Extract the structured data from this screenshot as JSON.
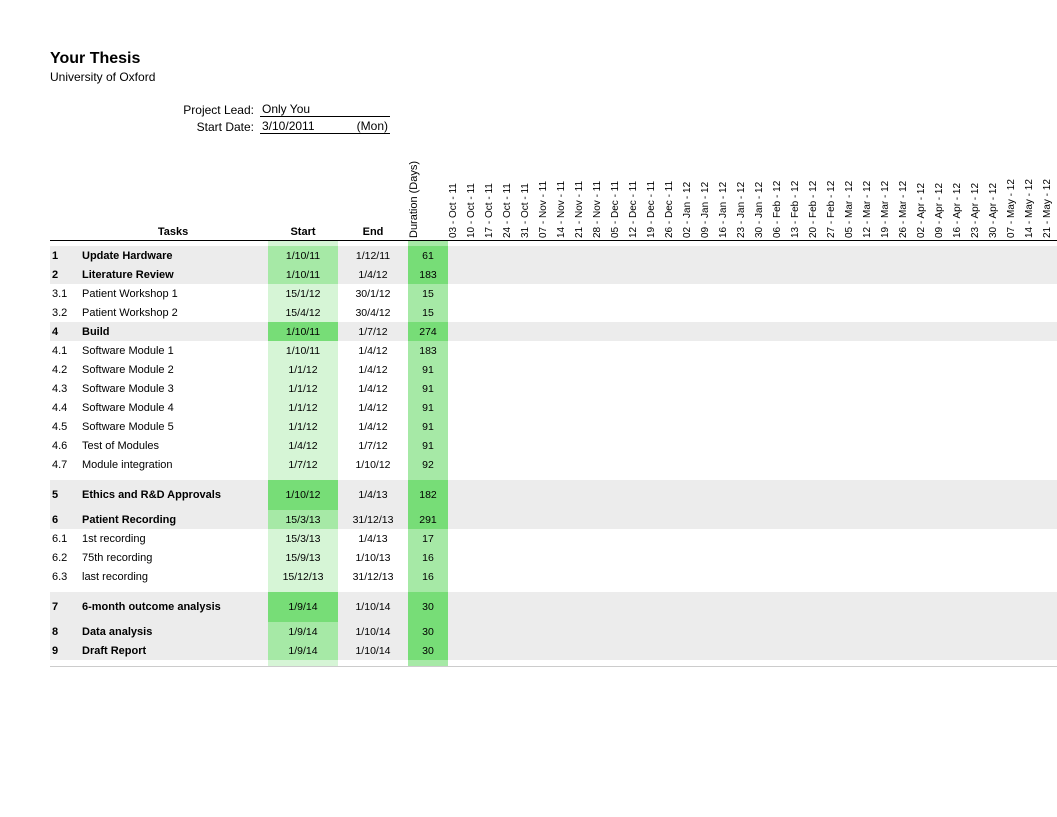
{
  "header": {
    "title": "Your Thesis",
    "subtitle": "University of Oxford",
    "project_lead_label": "Project Lead:",
    "project_lead_value": "Only You",
    "start_date_label": "Start Date:",
    "start_date_value": "3/10/2011",
    "start_date_dow": "(Mon)"
  },
  "columns": {
    "tasks": "Tasks",
    "start": "Start",
    "end": "End",
    "duration": "Duration (Days)"
  },
  "date_headers": [
    "03 - Oct - 11",
    "10 - Oct - 11",
    "17 - Oct - 11",
    "24 - Oct - 11",
    "31 - Oct - 11",
    "07 - Nov - 11",
    "14 - Nov - 11",
    "21 - Nov - 11",
    "28 - Nov - 11",
    "05 - Dec - 11",
    "12 - Dec - 11",
    "19 - Dec - 11",
    "26 - Dec - 11",
    "02 - Jan - 12",
    "09 - Jan - 12",
    "16 - Jan - 12",
    "23 - Jan - 12",
    "30 - Jan - 12",
    "06 - Feb - 12",
    "13 - Feb - 12",
    "20 - Feb - 12",
    "27 - Feb - 12",
    "05 - Mar - 12",
    "12 - Mar - 12",
    "19 - Mar - 12",
    "26 - Mar - 12",
    "02 - Apr - 12",
    "09 - Apr - 12",
    "16 - Apr - 12",
    "23 - Apr - 12",
    "30 - Apr - 12",
    "07 - May - 12",
    "14 - May - 12",
    "21 - May - 12"
  ],
  "groups": [
    {
      "rows": [
        {
          "num": "1",
          "task": "Update Hardware",
          "start": "1/10/11",
          "end": "1/12/11",
          "dur": "61",
          "bold": true,
          "shade": true,
          "sg": "med",
          "dg": "dark"
        },
        {
          "num": "2",
          "task": "Literature Review",
          "start": "1/10/11",
          "end": "1/4/12",
          "dur": "183",
          "bold": true,
          "shade": true,
          "sg": "med",
          "dg": "dark"
        },
        {
          "num": "3.1",
          "task": "Patient Workshop 1",
          "start": "15/1/12",
          "end": "30/1/12",
          "dur": "15",
          "bold": false,
          "shade": false,
          "sg": "lite",
          "dg": "med"
        },
        {
          "num": "3.2",
          "task": "Patient Workshop 2",
          "start": "15/4/12",
          "end": "30/4/12",
          "dur": "15",
          "bold": false,
          "shade": false,
          "sg": "lite",
          "dg": "med"
        },
        {
          "num": "4",
          "task": "Build",
          "start": "1/10/11",
          "end": "1/7/12",
          "dur": "274",
          "bold": true,
          "shade": true,
          "sg": "dark",
          "dg": "dark"
        },
        {
          "num": "4.1",
          "task": "Software Module 1",
          "start": "1/10/11",
          "end": "1/4/12",
          "dur": "183",
          "bold": false,
          "shade": false,
          "sg": "lite",
          "dg": "med"
        },
        {
          "num": "4.2",
          "task": "Software Module 2",
          "start": "1/1/12",
          "end": "1/4/12",
          "dur": "91",
          "bold": false,
          "shade": false,
          "sg": "lite",
          "dg": "med"
        },
        {
          "num": "4.3",
          "task": "Software Module 3",
          "start": "1/1/12",
          "end": "1/4/12",
          "dur": "91",
          "bold": false,
          "shade": false,
          "sg": "lite",
          "dg": "med"
        },
        {
          "num": "4.4",
          "task": "Software Module 4",
          "start": "1/1/12",
          "end": "1/4/12",
          "dur": "91",
          "bold": false,
          "shade": false,
          "sg": "lite",
          "dg": "med"
        },
        {
          "num": "4.5",
          "task": "Software Module 5",
          "start": "1/1/12",
          "end": "1/4/12",
          "dur": "91",
          "bold": false,
          "shade": false,
          "sg": "lite",
          "dg": "med"
        },
        {
          "num": "4.6",
          "task": "Test of Modules",
          "start": "1/4/12",
          "end": "1/7/12",
          "dur": "91",
          "bold": false,
          "shade": false,
          "sg": "lite",
          "dg": "med"
        },
        {
          "num": "4.7",
          "task": "Module integration",
          "start": "1/7/12",
          "end": "1/10/12",
          "dur": "92",
          "bold": false,
          "shade": false,
          "sg": "lite",
          "dg": "med"
        }
      ]
    },
    {
      "rows": [
        {
          "num": "5",
          "task": "Ethics and R&D Approvals",
          "start": "1/10/12",
          "end": "1/4/13",
          "dur": "182",
          "bold": true,
          "shade": true,
          "sg": "dark",
          "dg": "dark",
          "tall": true
        },
        {
          "num": "6",
          "task": "Patient Recording",
          "start": "15/3/13",
          "end": "31/12/13",
          "dur": "291",
          "bold": true,
          "shade": true,
          "sg": "med",
          "dg": "dark"
        },
        {
          "num": "6.1",
          "task": "1st  recording",
          "start": "15/3/13",
          "end": "1/4/13",
          "dur": "17",
          "bold": false,
          "shade": false,
          "sg": "lite",
          "dg": "med"
        },
        {
          "num": "6.2",
          "task": "75th recording",
          "start": "15/9/13",
          "end": "1/10/13",
          "dur": "16",
          "bold": false,
          "shade": false,
          "sg": "lite",
          "dg": "med"
        },
        {
          "num": "6.3",
          "task": "last recording",
          "start": "15/12/13",
          "end": "31/12/13",
          "dur": "16",
          "bold": false,
          "shade": false,
          "sg": "lite",
          "dg": "med"
        }
      ]
    },
    {
      "rows": [
        {
          "num": "7",
          "task": "6-month  outcome analysis",
          "start": "1/9/14",
          "end": "1/10/14",
          "dur": "30",
          "bold": true,
          "shade": true,
          "sg": "dark",
          "dg": "dark",
          "tall": true
        },
        {
          "num": "8",
          "task": "Data analysis",
          "start": "1/9/14",
          "end": "1/10/14",
          "dur": "30",
          "bold": true,
          "shade": true,
          "sg": "med",
          "dg": "dark"
        },
        {
          "num": "9",
          "task": "Draft Report",
          "start": "1/9/14",
          "end": "1/10/14",
          "dur": "30",
          "bold": true,
          "shade": true,
          "sg": "med",
          "dg": "dark"
        }
      ]
    }
  ]
}
